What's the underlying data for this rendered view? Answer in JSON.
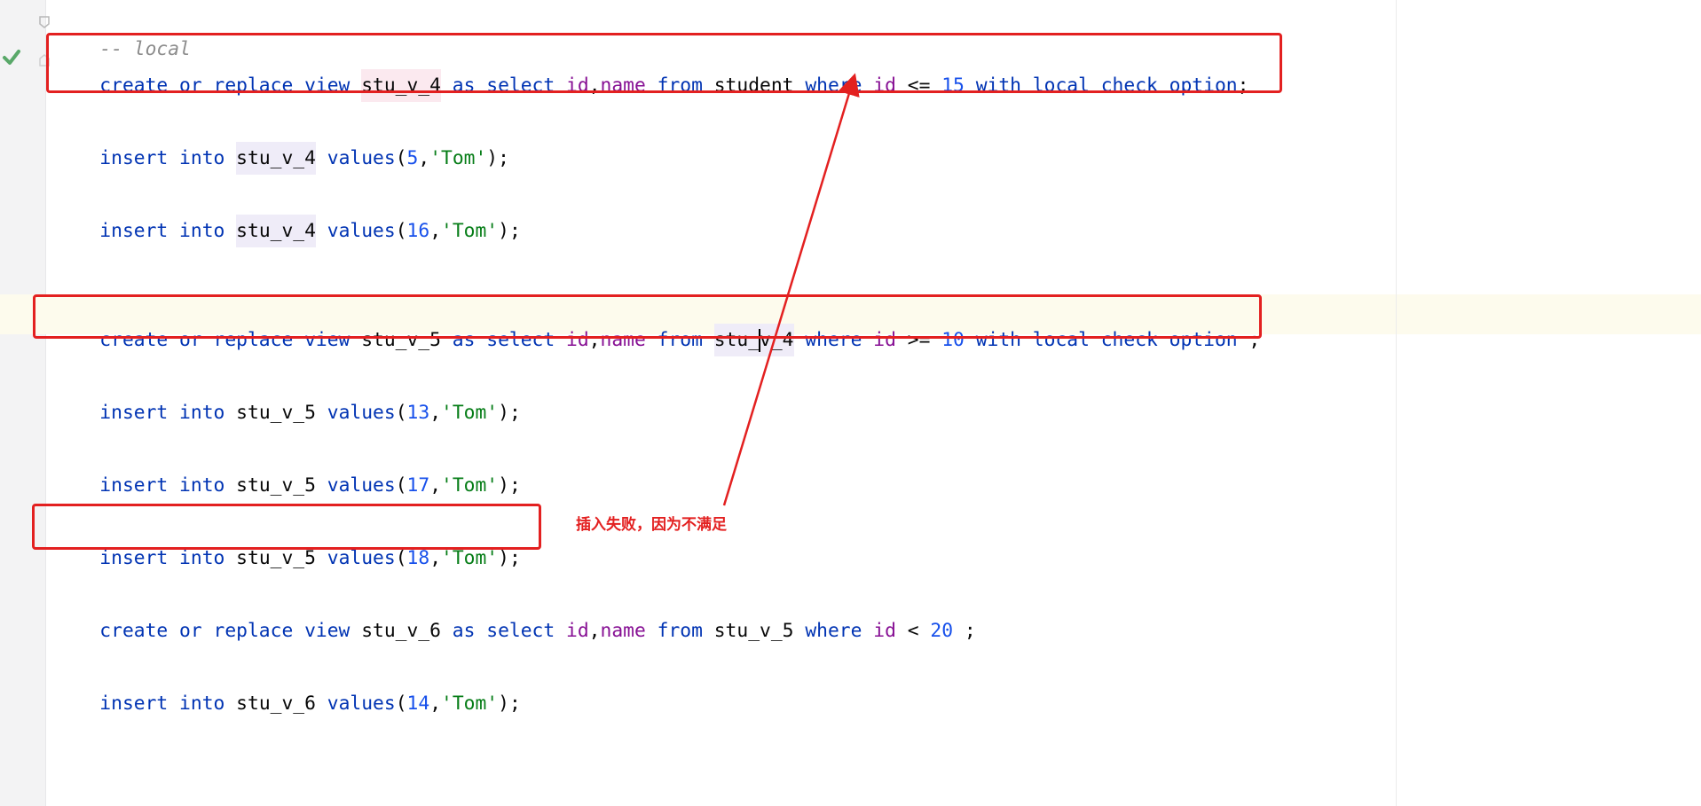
{
  "editor": {
    "lines": [
      {
        "text": "-- local"
      },
      {
        "text": "create or replace view stu_v_4 as select id,name from student where id <= 15 with local check option;"
      },
      {
        "text": "insert into stu_v_4 values(5,'Tom');"
      },
      {
        "text": "insert into stu_v_4 values(16,'Tom');"
      },
      {
        "text": "create or replace view stu_v_5 as select id,name from stu_v_4 where id >= 10 with local check option ;"
      },
      {
        "text": "insert into stu_v_5 values(13,'Tom');"
      },
      {
        "text": "insert into stu_v_5 values(17,'Tom');"
      },
      {
        "text": "insert into stu_v_5 values(18,'Tom');"
      },
      {
        "text": "create or replace view stu_v_6 as select id,name from stu_v_5 where id < 20 ;"
      },
      {
        "text": "insert into stu_v_6 values(14,'Tom');"
      }
    ],
    "gutter": {
      "check_icon": "check-icon",
      "fold_icons": [
        "fold-icon"
      ],
      "check_color": "#59a869"
    }
  },
  "annotation": {
    "text": "插入失败，因为不满足",
    "color": "#e32020"
  },
  "highlight_color": "#fdfbed"
}
